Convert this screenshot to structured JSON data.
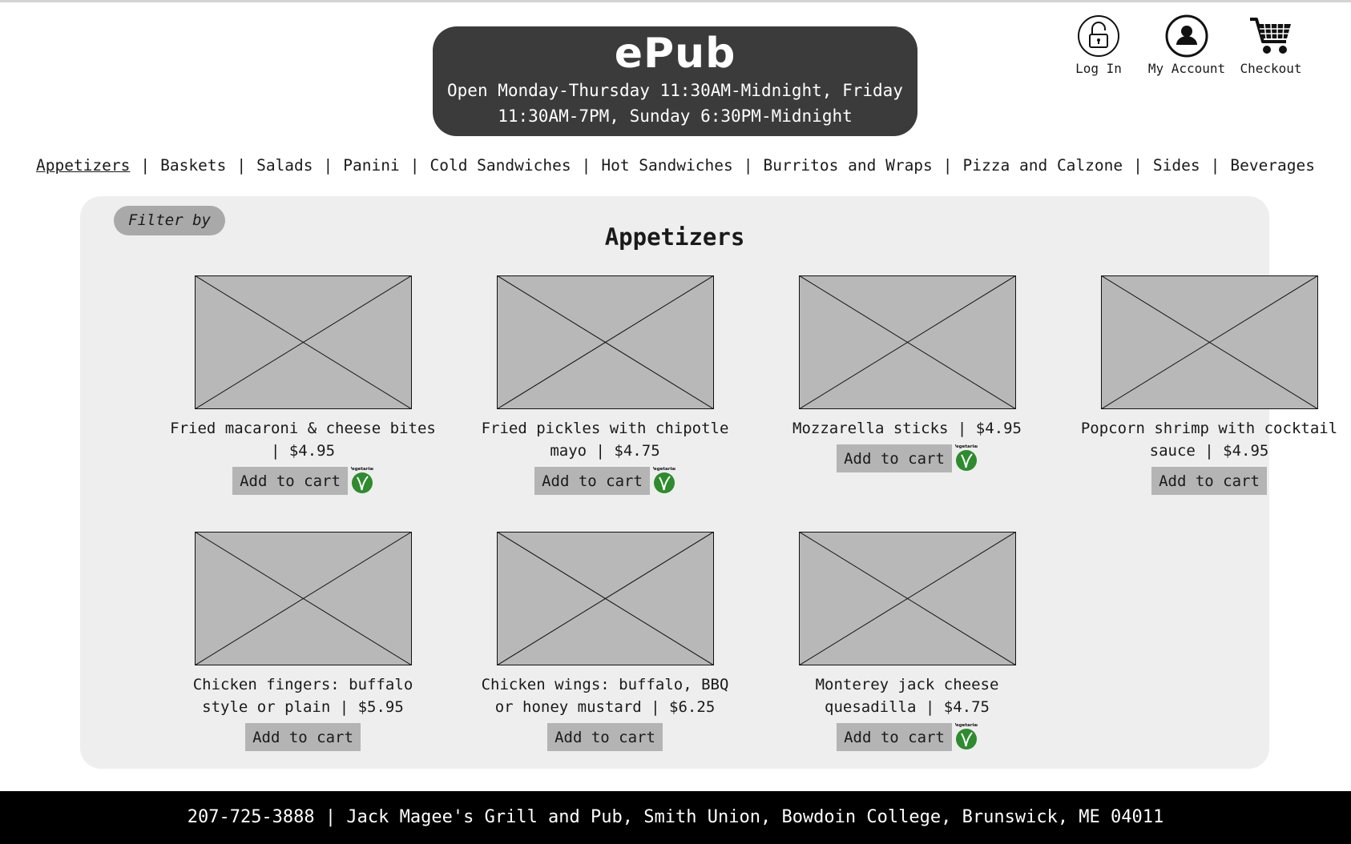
{
  "header": {
    "brand": "ePub",
    "hours": "Open Monday-Thursday 11:30AM-Midnight, Friday 11:30AM-7PM, Sunday 6:30PM-Midnight"
  },
  "account": {
    "login_label": "Log In",
    "login_icon": "lock-icon",
    "my_account_label": "My Account",
    "my_account_icon": "user-icon",
    "checkout_label": "Checkout",
    "checkout_icon": "cart-icon"
  },
  "categories": [
    {
      "label": "Appetizers",
      "active": true
    },
    {
      "label": "Baskets"
    },
    {
      "label": "Salads"
    },
    {
      "label": "Panini"
    },
    {
      "label": "Cold Sandwiches"
    },
    {
      "label": "Hot Sandwiches"
    },
    {
      "label": "Burritos and Wraps"
    },
    {
      "label": "Pizza and Calzone"
    },
    {
      "label": "Sides"
    },
    {
      "label": "Beverages"
    }
  ],
  "panel": {
    "filter_label": "Filter by",
    "section_title": "Appetizers"
  },
  "items": [
    {
      "name": "Fried macaroni & cheese bites | $4.95",
      "vegetarian": true
    },
    {
      "name": "Fried pickles with chipotle mayo | $4.75",
      "vegetarian": true
    },
    {
      "name": "Mozzarella sticks | $4.95",
      "vegetarian": true
    },
    {
      "name": "Popcorn shrimp with cocktail sauce | $4.95",
      "vegetarian": false
    },
    {
      "name": "Chicken fingers: buffalo style or plain | $5.95",
      "vegetarian": false
    },
    {
      "name": "Chicken wings: buffalo, BBQ or honey mustard | $6.25",
      "vegetarian": false
    },
    {
      "name": "Monterey jack cheese quesadilla | $4.75",
      "vegetarian": true
    }
  ],
  "add_to_cart_label": "Add to cart",
  "veg_badge_text": "Vegetarian",
  "footer": {
    "text": "207-725-3888 | Jack Magee's Grill and Pub, Smith Union, Bowdoin College, Brunswick, ME 04011"
  },
  "colors": {
    "banner": "#3b3b3b",
    "panel": "#eeeeee",
    "button": "#b4b4b4",
    "veg_green": "#2e8b2e",
    "footer": "#000000"
  }
}
